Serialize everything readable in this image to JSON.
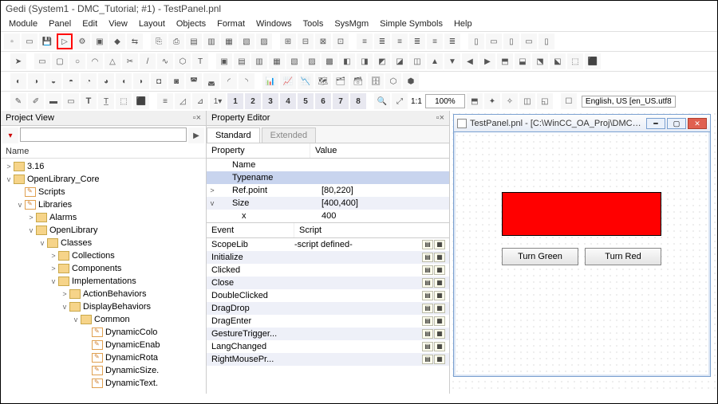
{
  "window_title": "Gedi (System1 - DMC_Tutorial; #1) - TestPanel.pnl",
  "menu": {
    "items": [
      "Module",
      "Panel",
      "Edit",
      "View",
      "Layout",
      "Objects",
      "Format",
      "Windows",
      "Tools",
      "SysMgm",
      "Simple Symbols",
      "Help"
    ]
  },
  "toolbar5": {
    "nums": [
      "1",
      "2",
      "3",
      "4",
      "5",
      "6",
      "7",
      "8"
    ],
    "zoom_ratio": "1:1",
    "zoom": "100%",
    "language": "English, US [en_US.utf8"
  },
  "project_view": {
    "title": "Project View",
    "header": "Name",
    "search_placeholder": "",
    "tree": [
      {
        "d": 0,
        "tw": ">",
        "ic": "fld",
        "label": "3.16"
      },
      {
        "d": 0,
        "tw": "v",
        "ic": "fld",
        "label": "OpenLibrary_Core"
      },
      {
        "d": 1,
        "tw": "",
        "ic": "scr",
        "label": "Scripts"
      },
      {
        "d": 1,
        "tw": "v",
        "ic": "scr",
        "label": "Libraries"
      },
      {
        "d": 2,
        "tw": ">",
        "ic": "fld",
        "label": "Alarms"
      },
      {
        "d": 2,
        "tw": "v",
        "ic": "fld",
        "label": "OpenLibrary"
      },
      {
        "d": 3,
        "tw": "v",
        "ic": "fld",
        "label": "Classes"
      },
      {
        "d": 4,
        "tw": ">",
        "ic": "fld",
        "label": "Collections"
      },
      {
        "d": 4,
        "tw": ">",
        "ic": "fld",
        "label": "Components"
      },
      {
        "d": 4,
        "tw": "v",
        "ic": "fld",
        "label": "Implementations"
      },
      {
        "d": 5,
        "tw": ">",
        "ic": "fld",
        "label": "ActionBehaviors"
      },
      {
        "d": 5,
        "tw": "v",
        "ic": "fld",
        "label": "DisplayBehaviors"
      },
      {
        "d": 6,
        "tw": "v",
        "ic": "fld",
        "label": "Common"
      },
      {
        "d": 7,
        "tw": "",
        "ic": "scr",
        "label": "DynamicColo"
      },
      {
        "d": 7,
        "tw": "",
        "ic": "scr",
        "label": "DynamicEnab"
      },
      {
        "d": 7,
        "tw": "",
        "ic": "scr",
        "label": "DynamicRota"
      },
      {
        "d": 7,
        "tw": "",
        "ic": "scr",
        "label": "DynamicSize."
      },
      {
        "d": 7,
        "tw": "",
        "ic": "scr",
        "label": "DynamicText."
      }
    ]
  },
  "property_editor": {
    "title": "Property Editor",
    "tabs": {
      "standard": "Standard",
      "extended": "Extended"
    },
    "prop_header": {
      "c1": "Property",
      "c2": "Value"
    },
    "props": [
      {
        "tw": "",
        "name": "Name",
        "value": "",
        "sel": false
      },
      {
        "tw": "",
        "name": "Typename",
        "value": "",
        "sel": true
      },
      {
        "tw": ">",
        "name": "Ref.point",
        "value": "[80,220]",
        "sel": false
      },
      {
        "tw": "v",
        "name": "Size",
        "value": "[400,400]",
        "sel": false,
        "alt": true
      },
      {
        "tw": "",
        "name": "x",
        "value": "400",
        "sel": false,
        "indent": true
      }
    ],
    "event_header": {
      "c1": "Event",
      "c2": "Script"
    },
    "events": [
      {
        "name": "ScopeLib",
        "script": "-script defined-"
      },
      {
        "name": "Initialize",
        "script": "",
        "alt": true
      },
      {
        "name": "Clicked",
        "script": ""
      },
      {
        "name": "Close",
        "script": "",
        "alt": true
      },
      {
        "name": "DoubleClicked",
        "script": ""
      },
      {
        "name": "DragDrop",
        "script": "",
        "alt": true
      },
      {
        "name": "DragEnter",
        "script": ""
      },
      {
        "name": "GestureTrigger...",
        "script": "",
        "alt": true
      },
      {
        "name": "LangChanged",
        "script": ""
      },
      {
        "name": "RightMousePr...",
        "script": "",
        "alt": true
      }
    ]
  },
  "canvas": {
    "win_title": "TestPanel.pnl - [C:\\WinCC_OA_Proj\\DMC_Tutori...",
    "btn_green": "Turn Green",
    "btn_red": "Turn Red"
  }
}
